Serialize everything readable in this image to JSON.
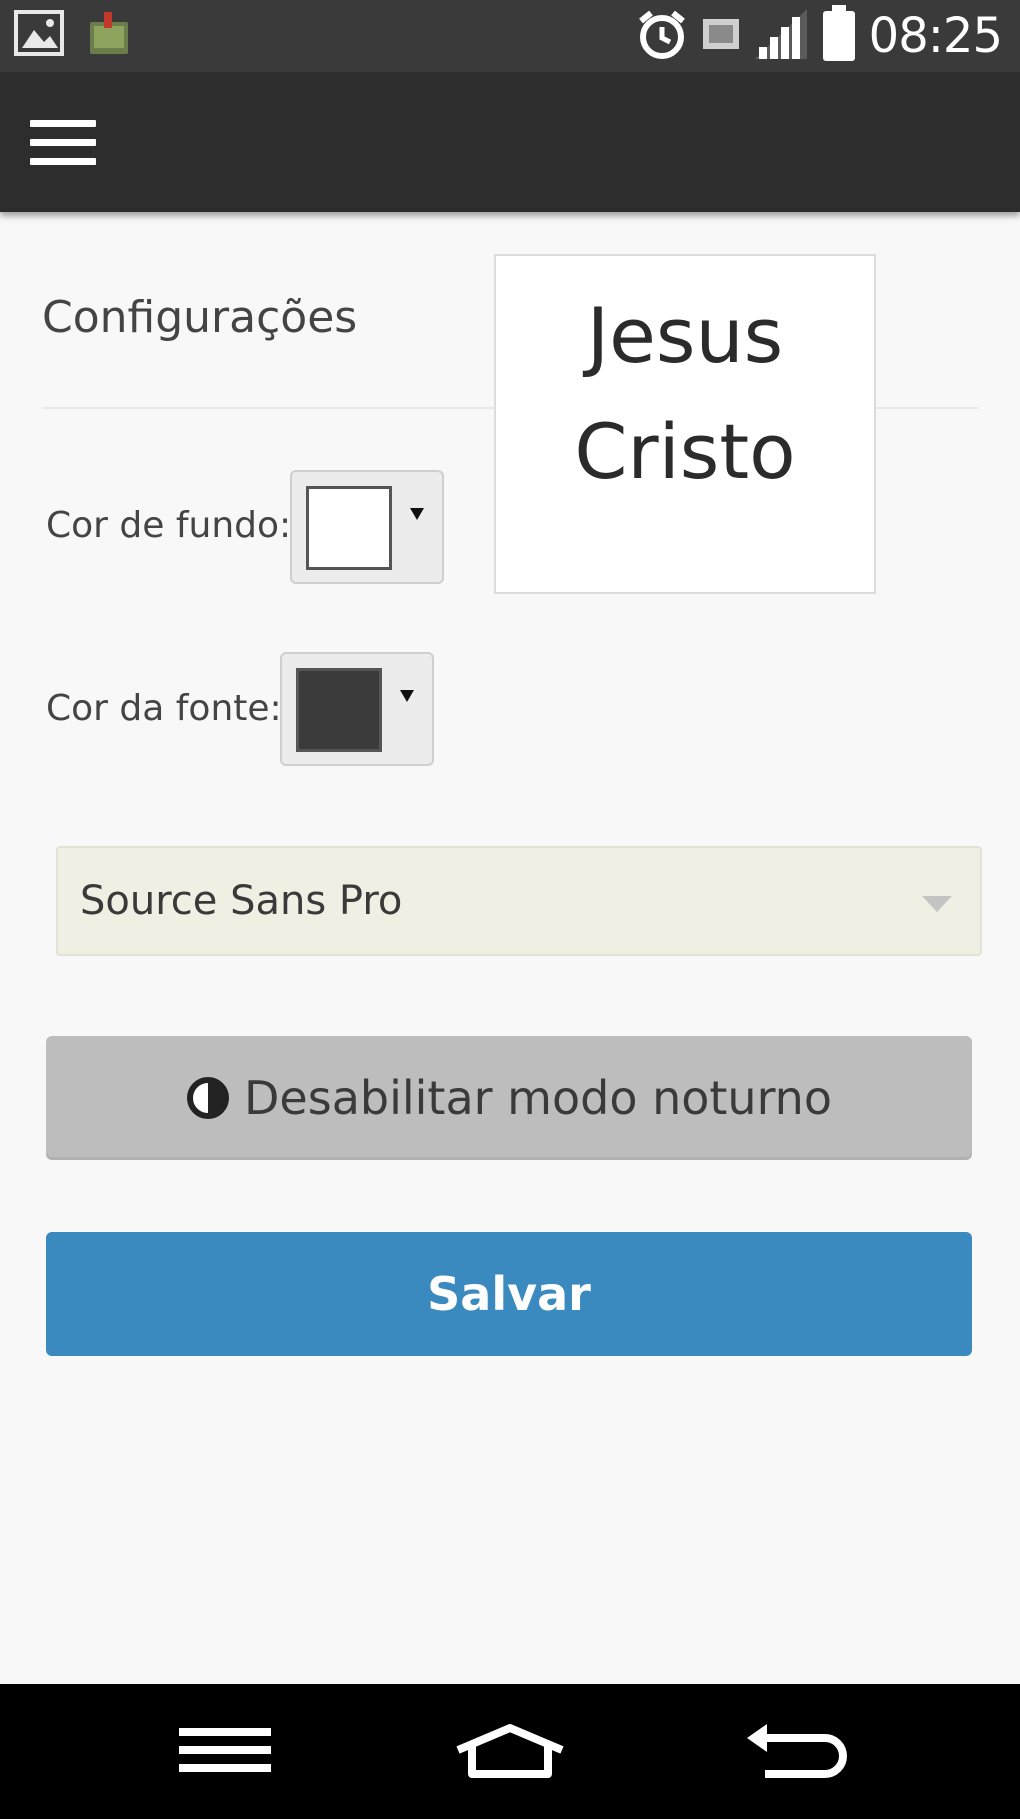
{
  "status_bar": {
    "time": "08:25",
    "icons": [
      "image-notification-icon",
      "bible-app-icon",
      "alarm-icon",
      "sim-icon",
      "signal-icon",
      "battery-icon"
    ]
  },
  "app_bar": {
    "menu_icon": "hamburger-menu-icon"
  },
  "settings": {
    "title": "Configurações",
    "background_color_label": "Cor de fundo:",
    "background_color_value": "#ffffff",
    "font_color_label": "Cor da fonte:",
    "font_color_value": "#3b3b3b",
    "font_select_value": "Source Sans Pro",
    "night_mode_label": "Desabilitar modo noturno",
    "save_label": "Salvar"
  },
  "preview": {
    "line1": "Jesus",
    "line2": "Cristo"
  },
  "nav_bar": {
    "icons": [
      "menu-icon",
      "home-icon",
      "back-icon"
    ]
  },
  "colors": {
    "status_bar": "#3a3a3a",
    "app_bar": "#2d2d2d",
    "save_button": "#3a8abf",
    "night_button": "#bdbdbd",
    "select_bg": "#efefe3"
  }
}
